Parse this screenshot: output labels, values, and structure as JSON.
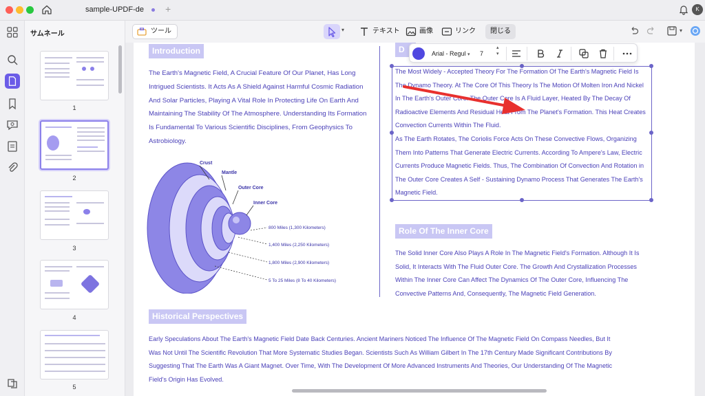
{
  "window": {
    "tab_title": "sample-UPDF-de",
    "new_tab": "+",
    "avatar_letter": "K"
  },
  "sidebar": {
    "title": "サムネール",
    "thumbnails": [
      {
        "page": "1"
      },
      {
        "page": "2"
      },
      {
        "page": "3"
      },
      {
        "page": "4"
      },
      {
        "page": "5"
      }
    ],
    "selected_page": "2"
  },
  "toolbar": {
    "tools_label": "ツール",
    "text_label": "テキスト",
    "image_label": "画像",
    "link_label": "リンク",
    "close_label": "閉じる"
  },
  "format_bar": {
    "color": "#5048e0",
    "font": "Arial - Regul",
    "size": "7"
  },
  "document": {
    "intro_title": "Introduction",
    "intro_lines": [
      "The Earth's Magnetic Field, A Crucial Feature Of Our Planet, Has Long",
      "Intrigued Scientists. It Acts As A Shield Against Harmful Cosmic Radiation",
      "And Solar Particles, Playing A Vital Role In Protecting Life On Earth And",
      "Maintaining The Stability Of The Atmosphere. Understanding Its Formation",
      "Is Fundamental To Various Scientific Disciplines, From Geophysics To",
      "Astrobiology."
    ],
    "diagram": {
      "crust": "Crust",
      "mantle": "Mantle",
      "outer_core": "Outer Core",
      "inner_core": "Inner Core",
      "m1": "800 Miles (1,300 Kilometers)",
      "m2": "1,400 Miles (2,250 Kilometers)",
      "m3": "1,800 Miles (2,900 Kilometers)",
      "m4": "5 To 25 Miles (8 To 40 Kilometers)"
    },
    "dynamo_title_partial": "D",
    "dynamo_lines": [
      "The Most Widely - Accepted Theory For The Formation Of The Earth's Magnetic Field Is",
      "The Dynamo Theory. At The Core Of This Theory Is The Motion Of Molten Iron And Nickel",
      "In The Earth's Outer Core. The Outer Core Is A Fluid Layer, Heated By The Decay Of",
      "Radioactive Elements And Residual Heat From The Planet's Formation. This Heat Creates",
      "Convection Currents Within The Fluid.",
      "As The Earth Rotates, The Coriolis Force Acts On These Convective Flows, Organizing",
      "Them Into Patterns That Generate Electric Currents. According To Ampere's Law, Electric",
      "Currents Produce Magnetic Fields. Thus, The Combination Of Convection And Rotation in",
      "The Outer Core Creates A Self - Sustaining Dynamo Process That Generates The Earth's",
      "Magnetic Field."
    ],
    "inner_title": "Role Of The Inner Core",
    "inner_lines": [
      "The Solid Inner Core Also Plays A Role In The Magnetic Field's Formation. Although It Is",
      "Solid, It Interacts With The Fluid Outer Core. The Growth And Crystallization Processes",
      "Within The Inner Core Can Affect The Dynamics Of The Outer Core, Influencing The",
      "Convective Patterns And, Consequently, The Magnetic Field Generation."
    ],
    "hist_title": "Historical Perspectives",
    "hist_lines": [
      "Early Speculations About The Earth's Magnetic Field Date Back Centuries. Ancient Mariners Noticed The Influence Of The Magnetic Field On Compass Needles, But It",
      "Was Not Until The Scientific Revolution That More Systematic Studies Began. Scientists Such As William Gilbert In The 17th Century Made Significant Contributions By",
      "Suggesting That The Earth Was A Giant Magnet. Over Time, With The Development Of More Advanced Instruments And Theories, Our Understanding Of The Magnetic",
      "Field's Origin Has Evolved."
    ]
  },
  "colors": {
    "accent": "#6b5ce7",
    "text_blue": "#4a40b8",
    "heading_bg": "#c9c7f4",
    "annotation_red": "#e8302e"
  }
}
